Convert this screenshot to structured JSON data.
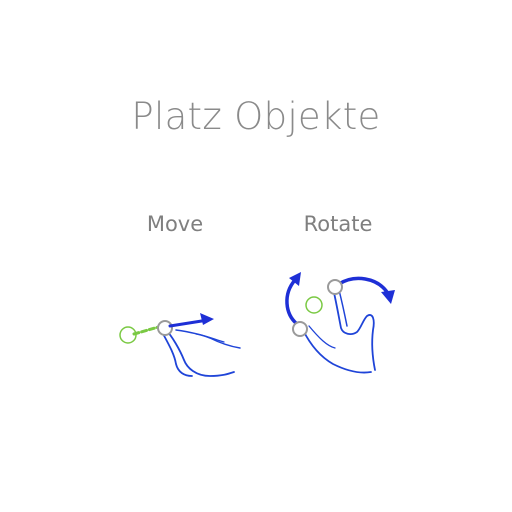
{
  "screen": {
    "title": "Platz Objekte"
  },
  "gestures": [
    {
      "label": "Move",
      "icon": "drag-gesture-icon"
    },
    {
      "label": "Rotate",
      "icon": "rotate-gesture-icon"
    }
  ],
  "colors": {
    "title": "#8a8a8a",
    "label": "#7f7f7f",
    "arrow": "#1e2fd6",
    "hand_outline": "#1f44d8",
    "start_point": "#7ac943",
    "touch_point": "#9a9a9a"
  }
}
